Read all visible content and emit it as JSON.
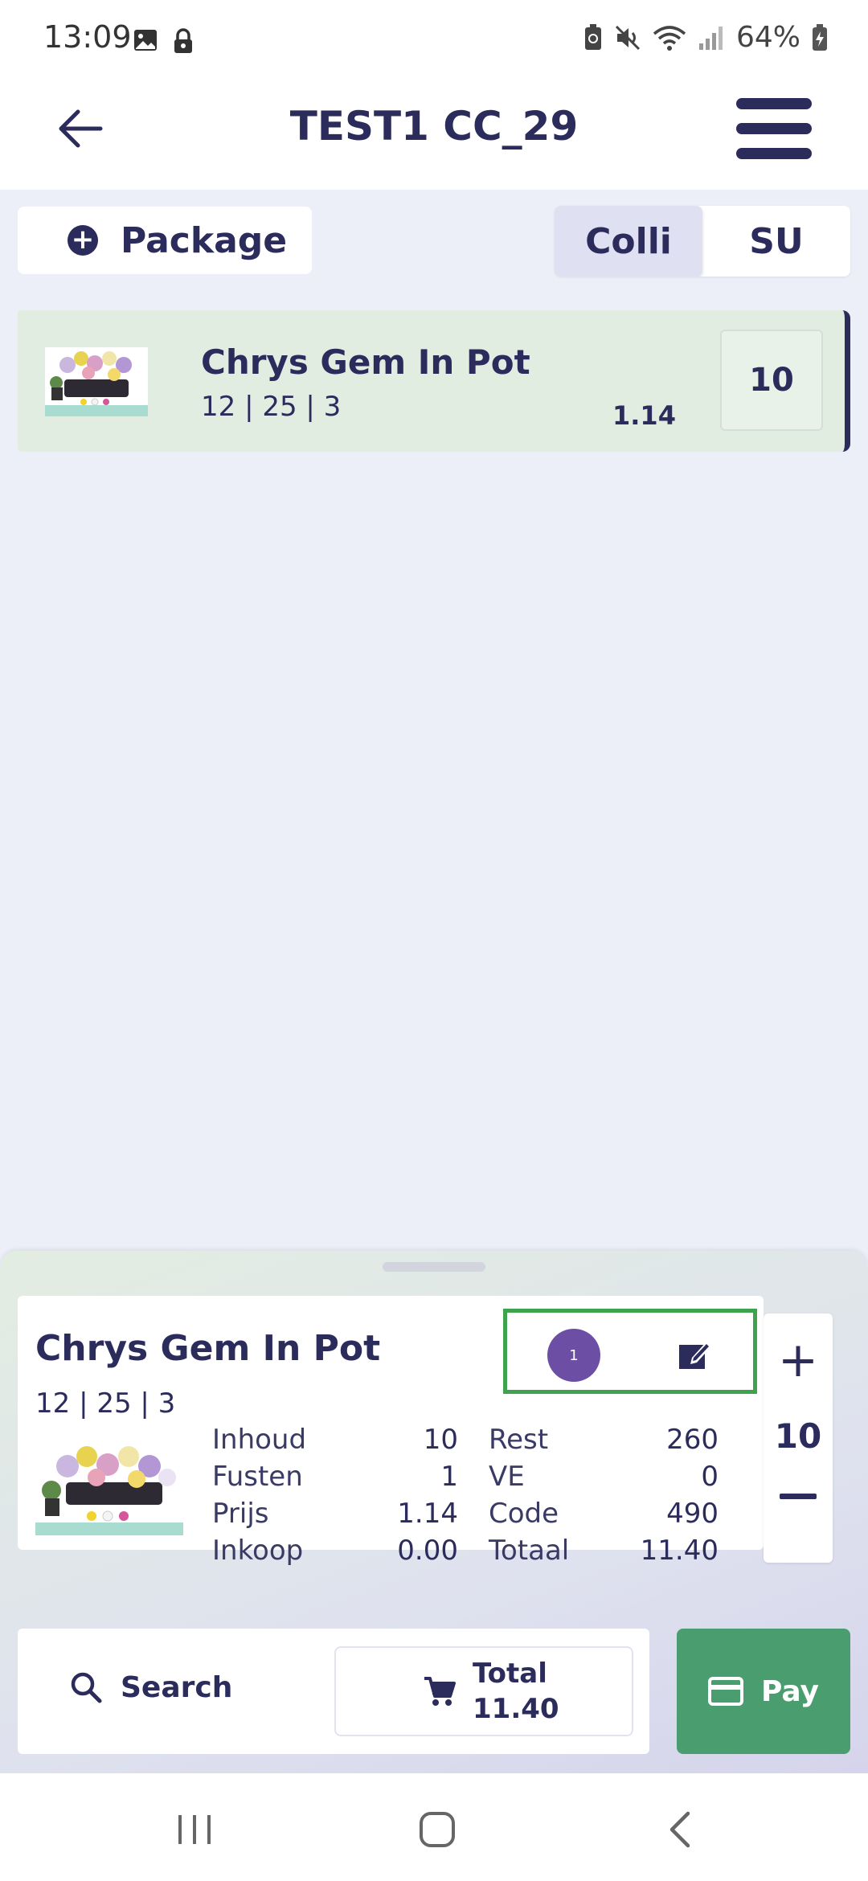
{
  "status_bar": {
    "time": "13:09",
    "battery": "64%"
  },
  "header": {
    "title": "TEST1 CC_29"
  },
  "package_button": {
    "label": "Package"
  },
  "unit_toggle": {
    "options": [
      "Colli",
      "SU"
    ],
    "selected": "Colli"
  },
  "product_row": {
    "name": "Chrys Gem In Pot",
    "sizes": "12 | 25 | 3",
    "price": "1.14",
    "quantity": "10"
  },
  "detail": {
    "name": "Chrys Gem In Pot",
    "sizes": "12 | 25 | 3",
    "badge_count": "1",
    "left_fields": [
      {
        "label": "Inhoud",
        "value": "10"
      },
      {
        "label": "Fusten",
        "value": "1"
      },
      {
        "label": "Prijs",
        "value": "1.14"
      },
      {
        "label": "Inkoop",
        "value": "0.00"
      }
    ],
    "right_fields": [
      {
        "label": "Rest",
        "value": "260"
      },
      {
        "label": "VE",
        "value": "0"
      },
      {
        "label": "Code",
        "value": "490"
      },
      {
        "label": "Totaal",
        "value": "11.40"
      }
    ],
    "stepper_value": "10"
  },
  "bottom": {
    "search_label": "Search",
    "total_label": "Total",
    "total_value": "11.40",
    "pay_label": "Pay"
  },
  "colors": {
    "primary": "#2b2b5c",
    "row_bg": "#e2ede1",
    "pay": "#4a9d6e",
    "badge": "#6c4fa5",
    "highlight": "#3fa34d"
  }
}
